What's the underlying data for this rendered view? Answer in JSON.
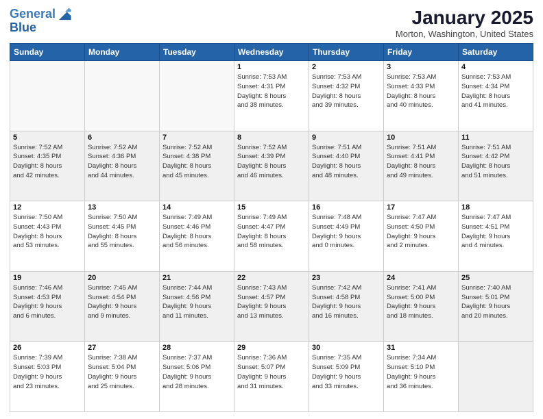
{
  "header": {
    "logo_line1": "General",
    "logo_line2": "Blue",
    "title": "January 2025",
    "location": "Morton, Washington, United States"
  },
  "days_of_week": [
    "Sunday",
    "Monday",
    "Tuesday",
    "Wednesday",
    "Thursday",
    "Friday",
    "Saturday"
  ],
  "weeks": [
    [
      {
        "day": "",
        "info": ""
      },
      {
        "day": "",
        "info": ""
      },
      {
        "day": "",
        "info": ""
      },
      {
        "day": "1",
        "info": "Sunrise: 7:53 AM\nSunset: 4:31 PM\nDaylight: 8 hours\nand 38 minutes."
      },
      {
        "day": "2",
        "info": "Sunrise: 7:53 AM\nSunset: 4:32 PM\nDaylight: 8 hours\nand 39 minutes."
      },
      {
        "day": "3",
        "info": "Sunrise: 7:53 AM\nSunset: 4:33 PM\nDaylight: 8 hours\nand 40 minutes."
      },
      {
        "day": "4",
        "info": "Sunrise: 7:53 AM\nSunset: 4:34 PM\nDaylight: 8 hours\nand 41 minutes."
      }
    ],
    [
      {
        "day": "5",
        "info": "Sunrise: 7:52 AM\nSunset: 4:35 PM\nDaylight: 8 hours\nand 42 minutes."
      },
      {
        "day": "6",
        "info": "Sunrise: 7:52 AM\nSunset: 4:36 PM\nDaylight: 8 hours\nand 44 minutes."
      },
      {
        "day": "7",
        "info": "Sunrise: 7:52 AM\nSunset: 4:38 PM\nDaylight: 8 hours\nand 45 minutes."
      },
      {
        "day": "8",
        "info": "Sunrise: 7:52 AM\nSunset: 4:39 PM\nDaylight: 8 hours\nand 46 minutes."
      },
      {
        "day": "9",
        "info": "Sunrise: 7:51 AM\nSunset: 4:40 PM\nDaylight: 8 hours\nand 48 minutes."
      },
      {
        "day": "10",
        "info": "Sunrise: 7:51 AM\nSunset: 4:41 PM\nDaylight: 8 hours\nand 49 minutes."
      },
      {
        "day": "11",
        "info": "Sunrise: 7:51 AM\nSunset: 4:42 PM\nDaylight: 8 hours\nand 51 minutes."
      }
    ],
    [
      {
        "day": "12",
        "info": "Sunrise: 7:50 AM\nSunset: 4:43 PM\nDaylight: 8 hours\nand 53 minutes."
      },
      {
        "day": "13",
        "info": "Sunrise: 7:50 AM\nSunset: 4:45 PM\nDaylight: 8 hours\nand 55 minutes."
      },
      {
        "day": "14",
        "info": "Sunrise: 7:49 AM\nSunset: 4:46 PM\nDaylight: 8 hours\nand 56 minutes."
      },
      {
        "day": "15",
        "info": "Sunrise: 7:49 AM\nSunset: 4:47 PM\nDaylight: 8 hours\nand 58 minutes."
      },
      {
        "day": "16",
        "info": "Sunrise: 7:48 AM\nSunset: 4:49 PM\nDaylight: 9 hours\nand 0 minutes."
      },
      {
        "day": "17",
        "info": "Sunrise: 7:47 AM\nSunset: 4:50 PM\nDaylight: 9 hours\nand 2 minutes."
      },
      {
        "day": "18",
        "info": "Sunrise: 7:47 AM\nSunset: 4:51 PM\nDaylight: 9 hours\nand 4 minutes."
      }
    ],
    [
      {
        "day": "19",
        "info": "Sunrise: 7:46 AM\nSunset: 4:53 PM\nDaylight: 9 hours\nand 6 minutes."
      },
      {
        "day": "20",
        "info": "Sunrise: 7:45 AM\nSunset: 4:54 PM\nDaylight: 9 hours\nand 9 minutes."
      },
      {
        "day": "21",
        "info": "Sunrise: 7:44 AM\nSunset: 4:56 PM\nDaylight: 9 hours\nand 11 minutes."
      },
      {
        "day": "22",
        "info": "Sunrise: 7:43 AM\nSunset: 4:57 PM\nDaylight: 9 hours\nand 13 minutes."
      },
      {
        "day": "23",
        "info": "Sunrise: 7:42 AM\nSunset: 4:58 PM\nDaylight: 9 hours\nand 16 minutes."
      },
      {
        "day": "24",
        "info": "Sunrise: 7:41 AM\nSunset: 5:00 PM\nDaylight: 9 hours\nand 18 minutes."
      },
      {
        "day": "25",
        "info": "Sunrise: 7:40 AM\nSunset: 5:01 PM\nDaylight: 9 hours\nand 20 minutes."
      }
    ],
    [
      {
        "day": "26",
        "info": "Sunrise: 7:39 AM\nSunset: 5:03 PM\nDaylight: 9 hours\nand 23 minutes."
      },
      {
        "day": "27",
        "info": "Sunrise: 7:38 AM\nSunset: 5:04 PM\nDaylight: 9 hours\nand 25 minutes."
      },
      {
        "day": "28",
        "info": "Sunrise: 7:37 AM\nSunset: 5:06 PM\nDaylight: 9 hours\nand 28 minutes."
      },
      {
        "day": "29",
        "info": "Sunrise: 7:36 AM\nSunset: 5:07 PM\nDaylight: 9 hours\nand 31 minutes."
      },
      {
        "day": "30",
        "info": "Sunrise: 7:35 AM\nSunset: 5:09 PM\nDaylight: 9 hours\nand 33 minutes."
      },
      {
        "day": "31",
        "info": "Sunrise: 7:34 AM\nSunset: 5:10 PM\nDaylight: 9 hours\nand 36 minutes."
      },
      {
        "day": "",
        "info": ""
      }
    ]
  ]
}
